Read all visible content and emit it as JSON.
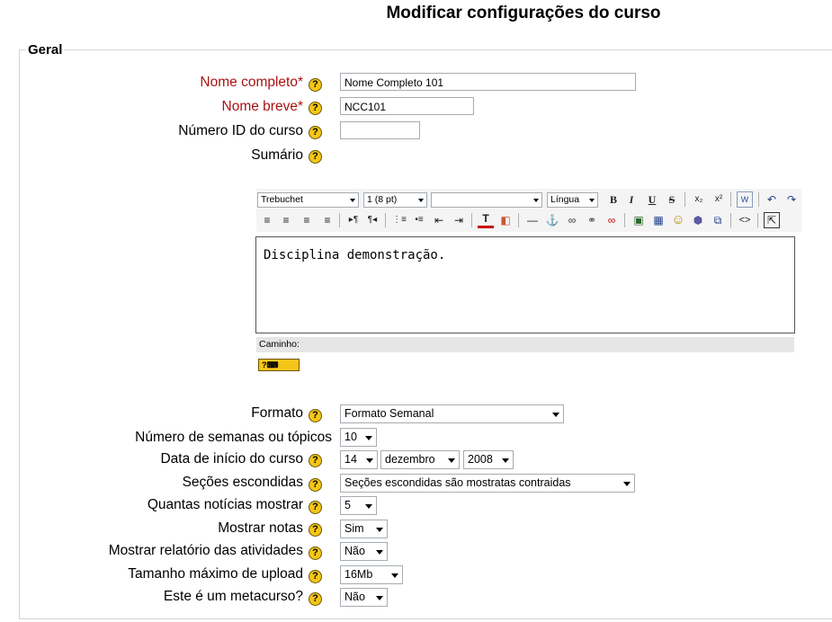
{
  "page": {
    "title": "Modificar configurações do curso"
  },
  "section": {
    "legend": "Geral"
  },
  "fields": {
    "nome_completo": {
      "label": "Nome completo*",
      "value": "Nome Completo 101"
    },
    "nome_breve": {
      "label": "Nome breve*",
      "value": "NCC101"
    },
    "numero_id": {
      "label": "Número ID do curso",
      "value": ""
    },
    "sumario": {
      "label": "Sumário"
    },
    "formato": {
      "label": "Formato",
      "value": "Formato Semanal"
    },
    "semanas": {
      "label": "Número de semanas ou tópicos",
      "value": "10"
    },
    "data_inicio": {
      "label": "Data de início do curso",
      "day": "14",
      "month": "dezembro",
      "year": "2008"
    },
    "secoes": {
      "label": "Seções escondidas",
      "value": "Seções escondidas são mostratas contraidas"
    },
    "noticias": {
      "label": "Quantas notícias mostrar",
      "value": "5"
    },
    "notas": {
      "label": "Mostrar notas",
      "value": "Sim"
    },
    "relatorio": {
      "label": "Mostrar relatório das atividades",
      "value": "Não"
    },
    "upload": {
      "label": "Tamanho máximo de upload",
      "value": "16Mb"
    },
    "metacurso": {
      "label": "Este é um metacurso?",
      "value": "Não"
    }
  },
  "help_glyph": "?",
  "editor": {
    "font": "Trebuchet",
    "size": "1 (8 pt)",
    "style": "",
    "language": "Língua",
    "content": "Disciplina demonstração.",
    "path_label": "Caminho:",
    "kbd_help": "?⌨",
    "buttons": {
      "bold": "B",
      "italic": "I",
      "underline": "U",
      "strike": "S",
      "sub": "x₂",
      "sup": "x²",
      "word": "W",
      "undo": "↶",
      "redo": "↷",
      "align_left": "≡",
      "align_center": "≡",
      "align_right": "≡",
      "justify": "≡",
      "ltr": "▸¶",
      "rtl": "¶◂",
      "ol": "⋮≡",
      "ul": "•≡",
      "outdent": "⇤",
      "indent": "⇥",
      "forecolor": "T",
      "backcolor": "◧",
      "hr": "—",
      "anchor": "⚓",
      "link": "∞",
      "unlink": "⚭",
      "nolink": "∞",
      "image": "▣",
      "table": "▦",
      "smiley": "☺",
      "special": "⬢",
      "search": "⧉",
      "html": "<>",
      "fullscreen": "⇱"
    }
  }
}
